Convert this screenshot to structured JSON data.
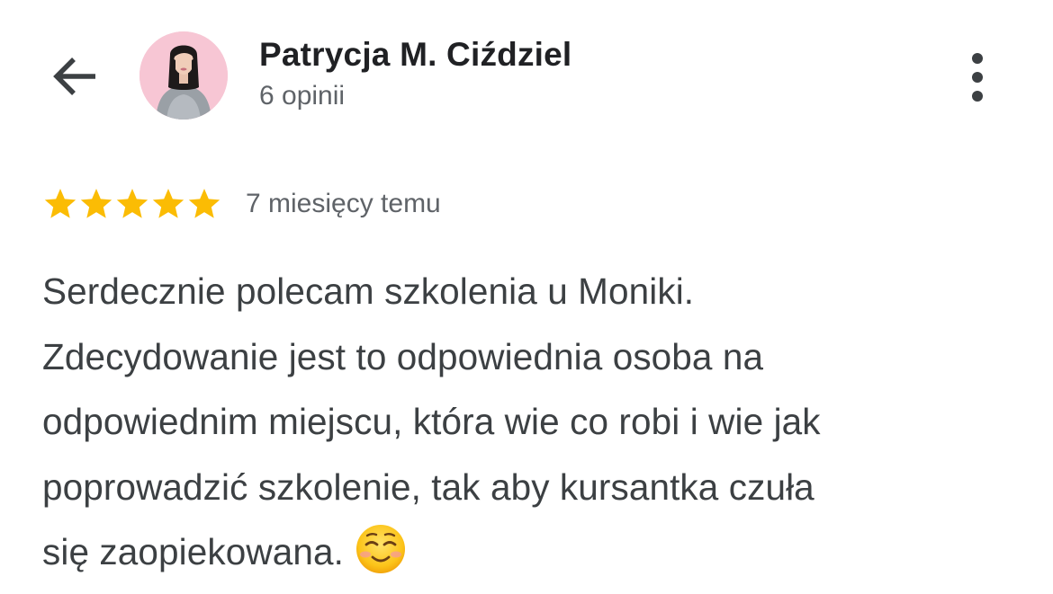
{
  "header": {
    "back_icon": "arrow-left-icon",
    "reviewer_name": "Patrycja M. Ciździel",
    "review_count": "6 opinii",
    "more_icon": "more-vertical-icon"
  },
  "review": {
    "rating": 5,
    "rating_max": 5,
    "star_color": "#fbbc04",
    "date": "7 miesięcy temu",
    "text_lines": [
      "Serdecznie polecam szkolenia u Moniki.",
      "Zdecydowanie jest to odpowiednia osoba na",
      "odpowiednim miejscu, która wie co robi i wie jak",
      "poprowadzić szkolenie, tak aby kursantka czuła",
      "się zaopiekowana."
    ],
    "emoji": "smiling-face-icon"
  }
}
